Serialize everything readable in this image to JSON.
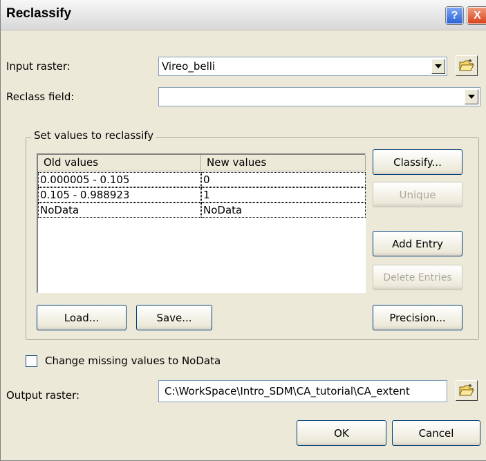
{
  "dialog": {
    "title": "Reclassify",
    "help_label": "?",
    "close_label": "X"
  },
  "input_raster": {
    "label": "Input raster:",
    "value": "Vireo_belli"
  },
  "reclass_field": {
    "label": "Reclass field:",
    "value": ""
  },
  "group": {
    "label": "Set values to reclassify",
    "columns": [
      "Old values",
      "New values"
    ],
    "rows": [
      {
        "old": "0.000005 - 0.105",
        "new": "0"
      },
      {
        "old": "0.105 - 0.988923",
        "new": "1"
      },
      {
        "old": "NoData",
        "new": "NoData"
      }
    ],
    "buttons": {
      "classify": "Classify...",
      "unique": "Unique",
      "add_entry": "Add Entry",
      "delete_entries": "Delete Entries",
      "load": "Load...",
      "save": "Save...",
      "precision": "Precision..."
    }
  },
  "missing_values": {
    "label": "Change missing values to NoData",
    "checked": false
  },
  "output_raster": {
    "label": "Output raster:",
    "value": "C:\\WorkSpace\\Intro_SDM\\CA_tutorial\\CA_extent"
  },
  "footer": {
    "ok": "OK",
    "cancel": "Cancel"
  },
  "colors": {
    "dialog_bg": "#ece9d8",
    "button_border": "#003c74",
    "disabled_text": "#aca899"
  },
  "icons": [
    "help-icon",
    "close-icon",
    "chevron-down-icon",
    "open-folder-icon"
  ]
}
